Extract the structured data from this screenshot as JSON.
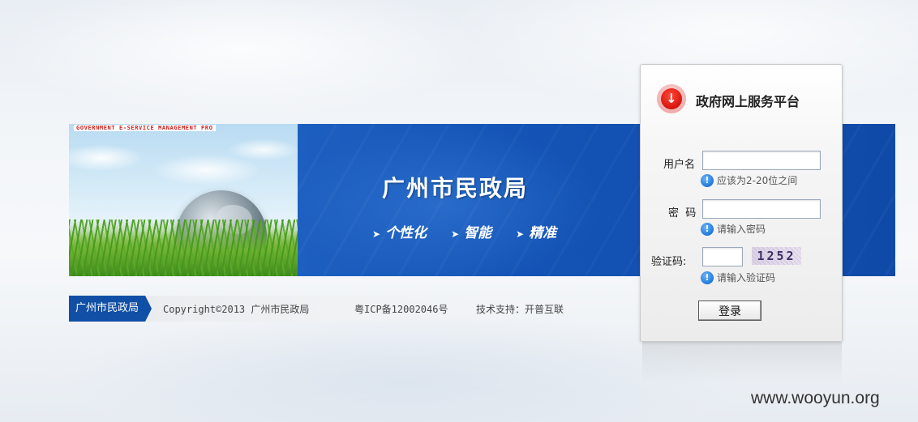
{
  "banner": {
    "tagline": "GOVERNMENT E-SERVICE MANAGEMENT PRO",
    "title": "广州市民政局",
    "slogans": [
      "个性化",
      "智能",
      "精准"
    ]
  },
  "footer": {
    "tag": "广州市民政局",
    "copyright": "Copyright©2013 广州市民政局",
    "icp": "粤ICP备12002046号",
    "support": "技术支持：开普互联"
  },
  "login": {
    "title": "政府网上服务平台",
    "username_label": "用户名",
    "username_value": "",
    "username_hint": "应该为2-20位之间",
    "password_label": "密  码",
    "password_value": "",
    "password_hint": "请输入密码",
    "captcha_label": "验证码:",
    "captcha_value": "",
    "captcha_code": "1252",
    "captcha_hint": "请输入验证码",
    "submit_label": "登录"
  },
  "watermark": "www.wooyun.org",
  "colors": {
    "banner_blue": "#1453b5",
    "footer_tag": "#114fa6",
    "login_icon": "#d8140c",
    "info_icon": "#1f78d8"
  },
  "icons": {
    "panel": "download-arrow-icon",
    "hint": "info-icon"
  }
}
